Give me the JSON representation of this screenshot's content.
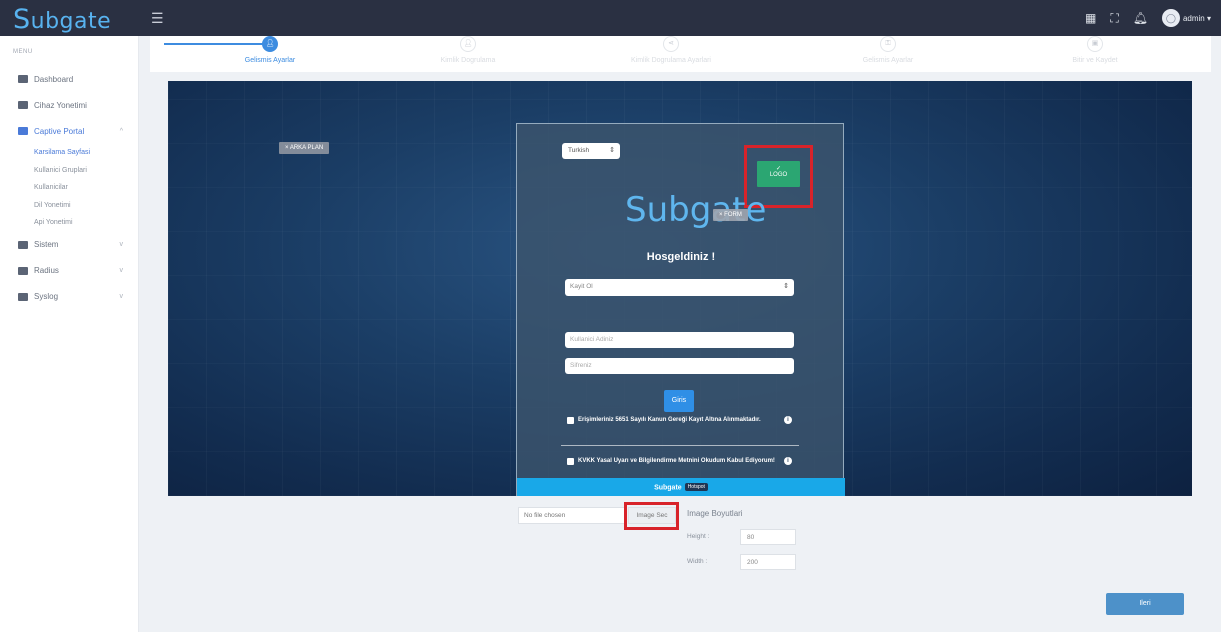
{
  "app": {
    "brand_s": "S",
    "brand_rest": "ubgate",
    "menu_icon": "hamburger-icon"
  },
  "topbar": {
    "user": "admin ▾",
    "icons": [
      "apps-grid-icon",
      "fullscreen-icon",
      "bell-icon",
      "user-avatar-icon"
    ]
  },
  "sidebar": {
    "menu_title": "MENU",
    "items": [
      {
        "label": "Dashboard"
      },
      {
        "label": "Cihaz Yonetimi"
      },
      {
        "label": "Captive Portal",
        "chev": "^"
      },
      {
        "label": "Sistem",
        "chev": "v"
      },
      {
        "label": "Radius",
        "chev": "v"
      },
      {
        "label": "Syslog",
        "chev": "v"
      }
    ],
    "sub_items": [
      "Karsilama Sayfasi",
      "Kullanici Gruplari",
      "Kullanicilar",
      "Dil Yonetimi",
      "Api Yonetimi"
    ]
  },
  "steps": [
    {
      "label": "Gelismis Ayarlar",
      "icon": "user"
    },
    {
      "label": "Kimlik Dogrulama",
      "icon": "user"
    },
    {
      "label": "Kimlik Dogrulama Ayarlari",
      "icon": "share"
    },
    {
      "label": "Gelismis Ayarlar",
      "icon": "key"
    },
    {
      "label": "Bitir ve Kaydet",
      "icon": "save"
    }
  ],
  "preview": {
    "bg_tag": "× ARKA PLAN",
    "form_tag": "× FORM",
    "language": "Turkish",
    "logo_btn_check": "✓",
    "logo_btn": "LOGO",
    "logo_text": "Subgate",
    "welcome": "Hosgeldiniz !",
    "select_value": "Kayit Ol",
    "username_placeholder": "Kullanici Adiniz",
    "password_placeholder": "Sifreniz",
    "login_btn": "Giris",
    "check1": "Erişimleriniz 5651 Sayılı Kanun Gereği Kayıt Altına Alınmaktadır.",
    "check2": "KVKK Yasal Uyarı ve Bilgilendirme Metnini Okudum Kabul Ediyorum!",
    "footer": "Subgate",
    "footer_badge": "Hotspot"
  },
  "upload": {
    "file_status": "No file chosen",
    "button": "Image Sec",
    "dims_title": "Image Boyutlari",
    "height_label": "Height :",
    "height_value": "80",
    "width_label": "Width :",
    "width_value": "200"
  },
  "next_btn": "Ileri",
  "colors": {
    "accent": "#3d8ce0",
    "topbar": "#2a3042",
    "highlight": "#d8232a",
    "logo_btn": "#2ba672"
  }
}
